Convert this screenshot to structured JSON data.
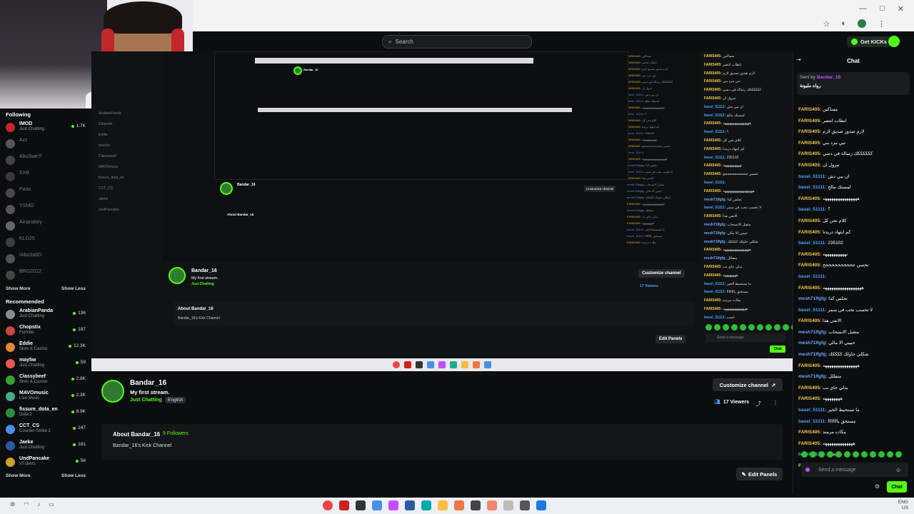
{
  "browser": {
    "search_placeholder": "Search",
    "get_kicks_label": "Get KICKs"
  },
  "sidebar": {
    "following_title": "Following",
    "following": [
      {
        "name": "IMOD",
        "category": "Just Chatting",
        "viewers": "1.7K",
        "live": true
      },
      {
        "name": "Azz",
        "category": "",
        "viewers": "",
        "live": false
      },
      {
        "name": "AbuSwe7l",
        "category": "",
        "viewers": "",
        "live": false
      },
      {
        "name": "SXB",
        "category": "",
        "viewers": "",
        "live": false
      },
      {
        "name": "Fwaz",
        "category": "",
        "viewers": "",
        "live": false
      },
      {
        "name": "YSMO",
        "category": "",
        "viewers": "",
        "live": false
      },
      {
        "name": "Ainaratory",
        "category": "",
        "viewers": "",
        "live": false
      },
      {
        "name": "KLO25",
        "category": "",
        "viewers": "",
        "live": false
      },
      {
        "name": "IAbo3a8D",
        "category": "",
        "viewers": "",
        "live": false
      },
      {
        "name": "BRG2022",
        "category": "",
        "viewers": "",
        "live": false
      }
    ],
    "show_more": "Show More",
    "show_less": "Show Less",
    "recommended_title": "Recommended",
    "recommended": [
      {
        "name": "ArabianPanda",
        "category": "Just Chatting",
        "viewers": "136"
      },
      {
        "name": "Chopstix",
        "category": "Fortnite",
        "viewers": "197"
      },
      {
        "name": "Eddie",
        "category": "Slots & Casino",
        "viewers": "12.3K"
      },
      {
        "name": "may5w",
        "category": "Just Chatting",
        "viewers": "59"
      },
      {
        "name": "Classybeef",
        "category": "Slots & Casino",
        "viewers": "2.8K"
      },
      {
        "name": "MAVOmusic",
        "category": "Live Music",
        "viewers": "2.3K"
      },
      {
        "name": "fissure_dota_en",
        "category": "Dota 2",
        "viewers": "8.9K"
      },
      {
        "name": "CCT_CS",
        "category": "Counter-Strike 2",
        "viewers": "247"
      },
      {
        "name": "Jaeke",
        "category": "Just Chatting",
        "viewers": "181"
      },
      {
        "name": "UndPancake",
        "category": "VTubers",
        "viewers": "58"
      }
    ]
  },
  "stream": {
    "channel_name": "Bandar_16",
    "title": "My first stream.",
    "category": "Just Chatting",
    "language": "English",
    "customize_label": "Customize channel",
    "viewers_label": "17 Viewers",
    "about_title": "About Bandar_16",
    "followers_label": "9 Followers",
    "about_description": "Bandar_16's Kick Channel",
    "edit_panels_label": "Edit Panels"
  },
  "chat": {
    "title": "Chat",
    "pinned_by": "Sent by",
    "pinned_user": "Bandar_16",
    "pinned_msg": "رواه مليونة",
    "input_placeholder": "Send a message",
    "send_label": "Chat",
    "messages": [
      {
        "user": "FARIS405",
        "text": "مساكين",
        "color": "#f2c94c"
      },
      {
        "user": "FARIS405",
        "text": "انطاب انتصر",
        "color": "#f2c94c"
      },
      {
        "user": "FARIS405",
        "text": "لازم صدور صديق لازم",
        "color": "#f2c94c"
      },
      {
        "user": "FARIS405",
        "text": "تبي مرد بني",
        "color": "#f2c94c"
      },
      {
        "user": "FARIS405",
        "text": "ككككككك رسالة في دسي",
        "color": "#f2c94c"
      },
      {
        "user": "FARIS405",
        "text": "تبزول ان",
        "color": "#f2c94c"
      },
      {
        "user": "basel_51111",
        "text": "ان يبي دش",
        "color": "#4ea1ff"
      },
      {
        "user": "basel_51111",
        "text": "لمستك مالح",
        "color": "#4ea1ff"
      },
      {
        "user": "FARIS405",
        "text": "ههههههههههههههههه",
        "color": "#f2c94c"
      },
      {
        "user": "basel_51111",
        "text": "؟",
        "color": "#4ea1ff"
      },
      {
        "user": "FARIS405",
        "text": "كلام نحن كل",
        "color": "#f2c94c"
      },
      {
        "user": "FARIS405",
        "text": "كم ايثهاد دريدنا",
        "color": "#f2c94c"
      },
      {
        "user": "basel_51111",
        "text": "235102",
        "color": "#4ea1ff"
      },
      {
        "user": "FARIS405",
        "text": "نههههههههههه",
        "color": "#f2c94c"
      },
      {
        "user": "FARIS405",
        "text": "تحسن جحححححححححح",
        "color": "#f2c94c"
      },
      {
        "user": "basel_51111",
        "text": "",
        "color": "#4ea1ff"
      },
      {
        "user": "FARIS405",
        "text": "ههههههههههههههههههه",
        "color": "#f2c94c"
      },
      {
        "user": "mesh71Ifgfg",
        "text": "تجلس كذا",
        "color": "#6fa8ff"
      },
      {
        "user": "basel_51111",
        "text": "لا تحسب نحب في سمر",
        "color": "#4ea1ff"
      },
      {
        "user": "FARIS405",
        "text": "الانفي هذا",
        "color": "#f2c94c"
      },
      {
        "user": "mesh71Ifgfg",
        "text": "متقبل الانسحاب",
        "color": "#6fa8ff"
      },
      {
        "user": "mesh71Ifgfg",
        "text": "حبيبي الا مالي",
        "color": "#6fa8ff"
      },
      {
        "user": "mesh71Ifgfg",
        "text": "شكلي حاولك ككككك",
        "color": "#6fa8ff"
      },
      {
        "user": "FARIS405",
        "text": "ههههههههههههههههه",
        "color": "#f2c94c"
      },
      {
        "user": "mesh71Ifgfg",
        "text": "متفللل",
        "color": "#6fa8ff"
      },
      {
        "user": "FARIS405",
        "text": "يدلي جاي نب",
        "color": "#f2c94c"
      },
      {
        "user": "FARIS405",
        "text": "ههههههههه",
        "color": "#f2c94c"
      },
      {
        "user": "basel_51111",
        "text": "ما تستحيط الخير",
        "color": "#4ea1ff"
      },
      {
        "user": "basel_51111",
        "text": "مستحق ياااااااا",
        "color": "#4ea1ff"
      },
      {
        "user": "FARIS405",
        "text": "مكات مرمند",
        "color": "#f2c94c"
      },
      {
        "user": "FARIS405",
        "text": "ههههههههههههههه",
        "color": "#f2c94c"
      },
      {
        "user": "basel_51111",
        "text": "انجب",
        "color": "#4ea1ff"
      },
      {
        "user": "FARIS405",
        "text": "انا هنا",
        "color": "#f2c94c"
      }
    ]
  },
  "taskbar": {
    "lang": "ENG",
    "region": "US"
  }
}
